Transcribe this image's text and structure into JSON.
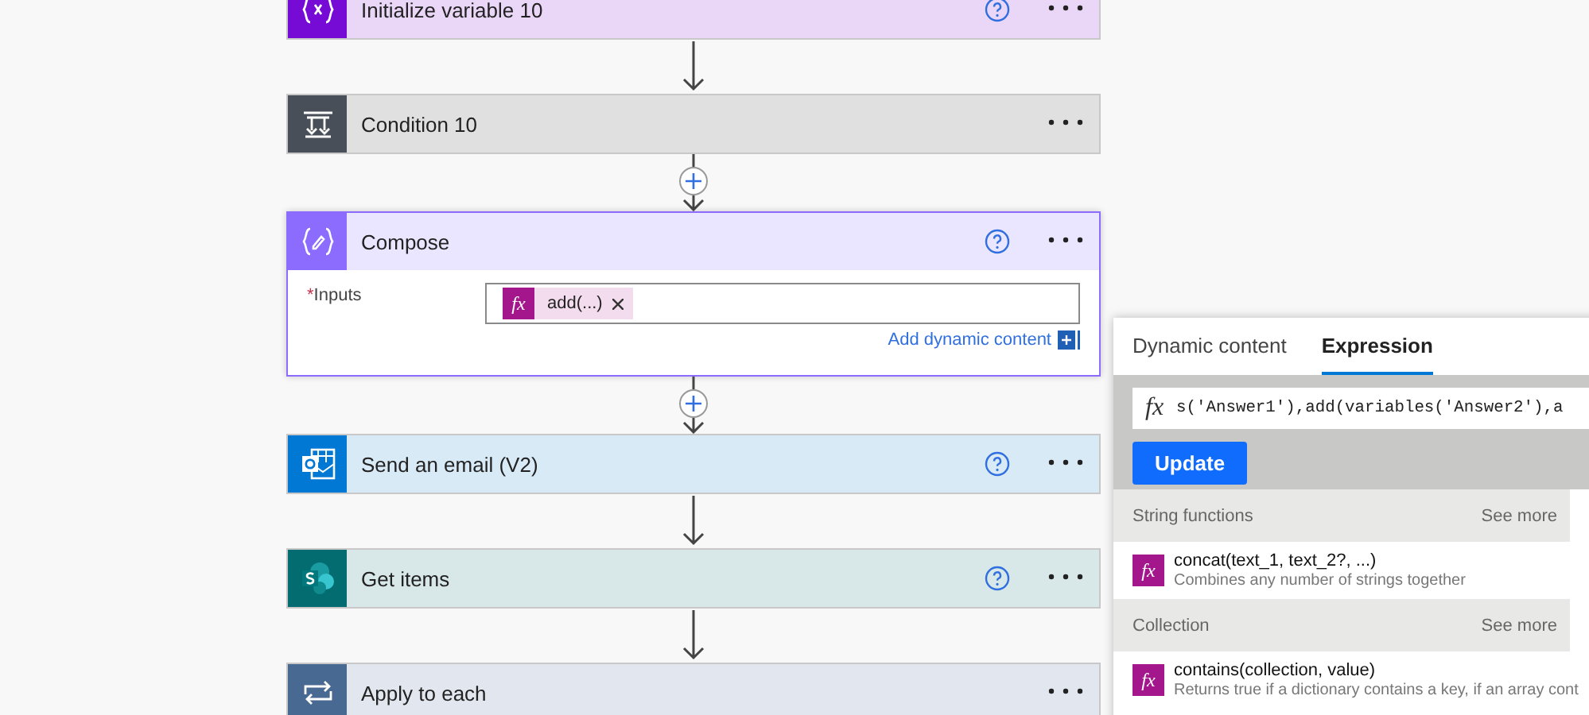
{
  "steps": [
    {
      "kind": "variable",
      "title": "Initialize variable 10",
      "help": true
    },
    {
      "kind": "condition",
      "title": "Condition 10",
      "help": false
    },
    {
      "kind": "compose",
      "title": "Compose",
      "help": true,
      "selected": true,
      "fields": [
        {
          "label": "Inputs",
          "required_mark": "*",
          "tokens": [
            {
              "icon": "fx",
              "label": "add(...)"
            }
          ]
        }
      ],
      "link": "Add dynamic content"
    },
    {
      "kind": "email",
      "title": "Send an email (V2)",
      "help": true
    },
    {
      "kind": "sharepoint",
      "title": "Get items",
      "help": true
    },
    {
      "kind": "loop",
      "title": "Apply to each",
      "help": false
    }
  ],
  "connectors": [
    {
      "kind": "arrow"
    },
    {
      "kind": "insert"
    },
    {
      "kind": "insert"
    },
    {
      "kind": "arrow"
    },
    {
      "kind": "arrow"
    }
  ],
  "panel": {
    "tabs": [
      {
        "label": "Dynamic content",
        "selected": false
      },
      {
        "label": "Expression",
        "selected": true
      }
    ],
    "expression_icon": "fx",
    "expression": "s('Answer1'),add(variables('Answer2'),a",
    "button": "Update",
    "sections": [
      {
        "title": "String functions",
        "see_more": "See more",
        "items": [
          {
            "icon": "fx",
            "name": "concat(text_1, text_2?, ...)",
            "description": "Combines any number of strings together"
          }
        ]
      },
      {
        "title": "Collection",
        "see_more": "See more",
        "items": [
          {
            "icon": "fx",
            "name": "contains(collection, value)",
            "description": "Returns true if a dictionary contains a key, if an array cont"
          }
        ]
      }
    ]
  }
}
